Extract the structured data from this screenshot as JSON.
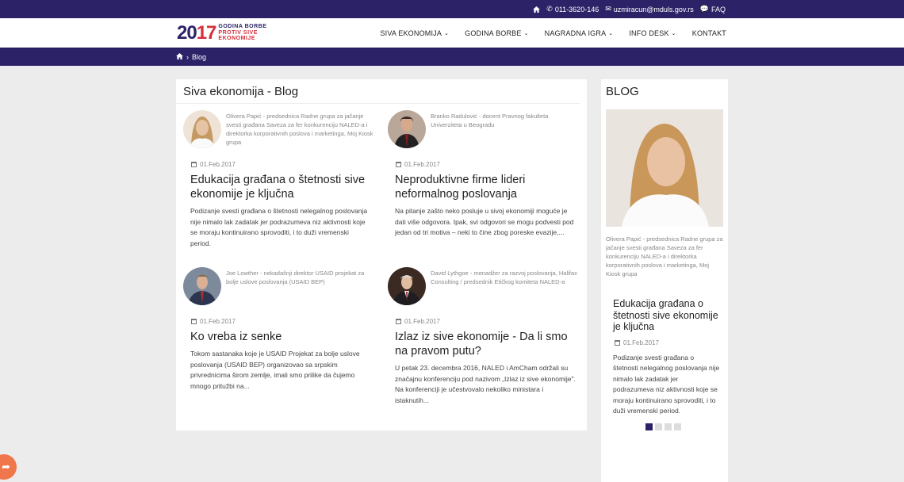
{
  "topbar": {
    "phone": "011-3620-146",
    "email": "uzmiracun@mduls.gov.rs",
    "faq": "FAQ"
  },
  "logo": {
    "year_a": "20",
    "year_b": "17",
    "line1": "GODINA BORBE",
    "line2": "PROTIV SIVE",
    "line3": "EKONOMIJE"
  },
  "nav": {
    "items": [
      "SIVA EKONOMIJA",
      "GODINA BORBE",
      "NAGRADNA IGRA",
      "INFO DESK",
      "KONTAKT"
    ]
  },
  "breadcrumb": {
    "current": "Blog"
  },
  "main": {
    "title": "Siva ekonomija - Blog",
    "posts": [
      {
        "author": "Olivera Papić - predsednica Radne grupa za jačanje svesti građana Saveza za fer konkurenciju NALED-a i direktorka korporativnih poslova i marketinga, Moj Kiosk grupa",
        "date": "01.Feb.2017",
        "title": "Edukacija građana o štetnosti sive ekonomije je ključna",
        "excerpt": "Podizanje svesti građana o štetnosti nelegalnog poslovanja nije nimalo lak zadatak jer podrazumeva niz aktivnosti koje se moraju kontinuirano sprovoditi, i to duži vremenski period."
      },
      {
        "author": "Branko Radulović - docent Pravnog fakulteta Univerziteta u Beogradu",
        "date": "01.Feb.2017",
        "title": "Neproduktivne firme lideri neformalnog poslovanja",
        "excerpt": "Na pitanje zašto neko posluje u sivoj ekonomiji moguće je dati više odgovora. Ipak, svi odgovori se mogu podvesti pod jedan od tri motiva – neki to čine zbog poreske evazije,..."
      },
      {
        "author": "Joe Lowther - nekadašnji direktor USAID projekat za bolje uslove poslovanja (USAID BEP)",
        "date": "01.Feb.2017",
        "title": "Ko vreba iz senke",
        "excerpt": "Tokom sastanaka koje je USAID Projekat za bolje uslove poslovanja (USAID BEP) organizovao sa srpskim privrednicima širom zemlje, imali smo prilike da čujemo mnogo pritužbi na..."
      },
      {
        "author": "David Lythgoe - menadžer za razvoj poslovanja, Halifax Consulting / predsednik Etičkog komiteta NALED-a",
        "date": "01.Feb.2017",
        "title": "Izlaz iz sive ekonomije - Da li smo na pravom putu?",
        "excerpt": "U petak 23. decembra 2016, NALED i AmCham održali su značajnu konferenciju pod nazivom „Izlaz iz sive ekonomije\". Na konferenciji je učestvovalo nekoliko ministara i istaknutih..."
      }
    ]
  },
  "sidebar": {
    "title": "BLOG",
    "author": "Olivera Papić - predsednica Radne grupa za jačanje svesti građana Saveza za fer konkurenciju NALED-a i direktorka korporativnih poslova i marketinga, Moj Kiosk grupa",
    "post_title": "Edukacija građana o štetnosti sive ekonomije je ključna",
    "date": "01.Feb.2017",
    "excerpt": "Podizanje svesti građana o štetnosti nelegalnog poslovanja nije nimalo lak zadatak jer podrazumeva niz aktivnosti koje se moraju kontinuirano sprovoditi, i to duži vremenski period."
  },
  "colors": {
    "brand": "#2c2267",
    "accent": "#d62f3c",
    "fab": "#f0764b"
  }
}
